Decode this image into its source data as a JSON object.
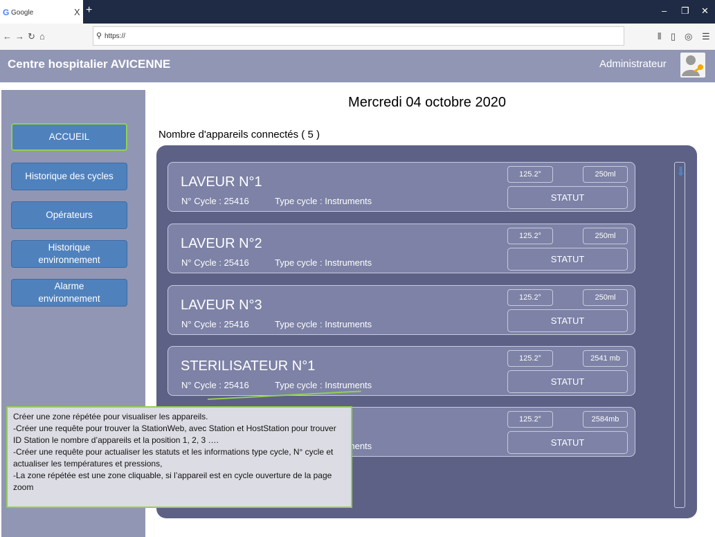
{
  "browser": {
    "tab_title": "Google",
    "tab_icon": "G",
    "url": "https://"
  },
  "header": {
    "title": "Centre hospitalier AVICENNE",
    "user_label": "Administrateur"
  },
  "sidebar": {
    "items": [
      {
        "label": "ACCUEIL",
        "active": true
      },
      {
        "label": "Historique des cycles"
      },
      {
        "label": "Opérateurs"
      },
      {
        "label": "Historique environnement"
      },
      {
        "label": "Alarme environnement"
      }
    ]
  },
  "main": {
    "date": "Mercredi 04 octobre 2020",
    "device_count_label": "Nombre d'appareils connectés ( 5 )",
    "devices": [
      {
        "name": "LAVEUR N°1",
        "cycle": "N° Cycle : 25416",
        "type": "Type cycle : Instruments",
        "temperature": "125.2°",
        "pressure": "250ml",
        "status": "STATUT"
      },
      {
        "name": "LAVEUR N°2",
        "cycle": "N° Cycle : 25416",
        "type": "Type cycle : Instruments",
        "temperature": "125.2°",
        "pressure": "250ml",
        "status": "STATUT"
      },
      {
        "name": "LAVEUR N°3",
        "cycle": "N° Cycle : 25416",
        "type": "Type cycle : Instruments",
        "temperature": "125.2°",
        "pressure": "250ml",
        "status": "STATUT"
      },
      {
        "name": "STERILISATEUR N°1",
        "cycle": "N° Cycle : 25416",
        "type": "Type cycle : Instruments",
        "temperature": "125.2°",
        "pressure": "2541 mb",
        "status": "STATUT"
      },
      {
        "name": "",
        "cycle": "",
        "type": "Type cycle : Instruments",
        "temperature": "125.2°",
        "pressure": "2584mb",
        "status": "STATUT"
      }
    ]
  },
  "note": {
    "lines": [
      "Créer une zone répétée pour visualiser les appareils.",
      "-Créer une requête pour trouver la StationWeb, avec Station et HostStation pour trouver ID Station le nombre d’appareils et la position 1, 2, 3 ….",
      "-Créer une requête pour actualiser les statuts et les informations  type cycle, N° cycle et actualiser les températures et pressions,",
      "-La zone répétée est une zone cliquable, si l’appareil est en cycle ouverture de la page zoom"
    ]
  },
  "colors": {
    "header_bg": "#9196b4",
    "panel_bg": "#5d6186",
    "card_bg": "#7d82a6",
    "nav_button": "#4f81bd",
    "active_border": "#92d050"
  }
}
